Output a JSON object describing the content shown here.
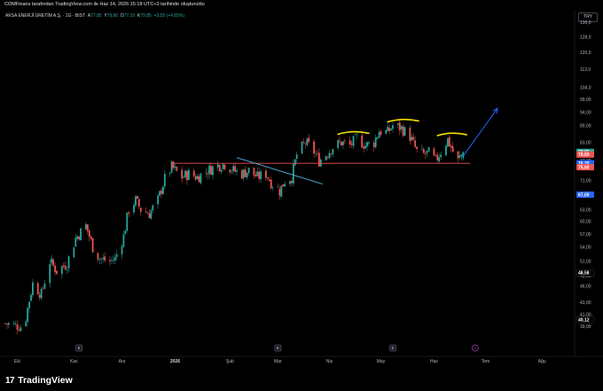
{
  "header": {
    "attribution": "COMFinans tarafından TradingView.com ile Haz 14, 2026 15:18 UTC+3 tarihinde oluşturuldu"
  },
  "legend": {
    "symbol": "AKSA ENERJİ ÜRETİM A.Ş. · 1G · BIST",
    "open_label": "A",
    "open": "77,85",
    "high_label": "Y",
    "high": "79,90",
    "low_label": "D",
    "low": "77,10",
    "close_label": "K",
    "close": "79,85",
    "change": "+3,55 (+4,65%)"
  },
  "currency_label": "TRY",
  "footer": {
    "brand": "TradingView",
    "logo": "17"
  },
  "colors": {
    "up": "#26a69a",
    "down": "#ef5350",
    "support": "#ef5350",
    "arrow": "#2962ff",
    "trend": "#4fb3e8",
    "arc": "#f7e000"
  },
  "chart_data": {
    "type": "candlestick",
    "y_scale": "log",
    "ylim": [
      35,
      136
    ],
    "xlim": [
      "2025-09-24",
      "2026-08-22"
    ],
    "y_ticks": [
      "136,0",
      "128,0",
      "120,0",
      "112,0",
      "104,0",
      "99,00",
      "94,00",
      "89,00",
      "83,00",
      "77,00",
      "71,00",
      "67,00",
      "63,00",
      "60,00",
      "57,00",
      "54,00",
      "51,00",
      "48,00",
      "46,00",
      "43,00",
      "41,00",
      "39,00"
    ],
    "y_tick_values": [
      136,
      128,
      120,
      112,
      104,
      99,
      94,
      89,
      83,
      77,
      71,
      67,
      63,
      60,
      57,
      54,
      51,
      48,
      46,
      43,
      41,
      39
    ],
    "x_ticks": [
      {
        "label": "Eki",
        "date": "2025-10-01",
        "bold": false
      },
      {
        "label": "Kas",
        "date": "2025-11-03",
        "bold": false
      },
      {
        "label": "Ara",
        "date": "2025-12-01",
        "bold": false
      },
      {
        "label": "2026",
        "date": "2026-01-01",
        "bold": true
      },
      {
        "label": "Şub",
        "date": "2026-02-02",
        "bold": false
      },
      {
        "label": "Mar",
        "date": "2026-03-02",
        "bold": false
      },
      {
        "label": "Nis",
        "date": "2026-04-01",
        "bold": false
      },
      {
        "label": "May",
        "date": "2026-05-01",
        "bold": false
      },
      {
        "label": "Haz",
        "date": "2026-06-01",
        "bold": false
      },
      {
        "label": "Tem",
        "date": "2026-07-01",
        "bold": false
      },
      {
        "label": "Ağu",
        "date": "2026-08-03",
        "bold": false
      }
    ],
    "price_badges": [
      {
        "label": "79,85",
        "value": 79.85,
        "color": "#26a69a"
      },
      {
        "label": "79,00",
        "value": 79.0,
        "color": "#ef5350"
      },
      {
        "label": "76,20",
        "value": 76.2,
        "color": "#2962ff"
      },
      {
        "label": "75,00",
        "value": 75.0,
        "color": "#ef5350"
      },
      {
        "label": "67,00",
        "value": 67.0,
        "color": "#2962ff"
      },
      {
        "label": "48,58",
        "value": 48.58,
        "color": "#000000"
      },
      {
        "label": "40,12",
        "value": 40.12,
        "color": "#000000"
      }
    ],
    "event_markers": [
      {
        "label": "E",
        "date": "2025-11-06"
      },
      {
        "label": "E",
        "date": "2026-03-02"
      },
      {
        "label": "E",
        "date": "2026-05-08"
      }
    ],
    "dividend_marker": {
      "label": "D",
      "date": "2026-06-25"
    },
    "support_level": {
      "value": 76.2,
      "from": "2025-12-30",
      "to": "2026-06-22"
    },
    "trendline": {
      "from": [
        "2026-02-06",
        78.0
      ],
      "to": [
        "2026-03-28",
        70.0
      ]
    },
    "arrow": {
      "from": [
        "2026-06-18",
        78.5
      ],
      "to": [
        "2026-07-08",
        95.5
      ]
    },
    "arcs": [
      {
        "from": "2026-04-06",
        "to": "2026-04-24",
        "y": 86.5
      },
      {
        "from": "2026-05-05",
        "to": "2026-05-23",
        "y": 91.0
      },
      {
        "from": "2026-06-03",
        "to": "2026-06-20",
        "y": 86.0
      }
    ],
    "anchors": [
      [
        "2025-09-24",
        39.5
      ],
      [
        "2025-10-03",
        39.0
      ],
      [
        "2025-10-06",
        40.5
      ],
      [
        "2025-10-10",
        46.5
      ],
      [
        "2025-10-15",
        44.5
      ],
      [
        "2025-10-20",
        51.0
      ],
      [
        "2025-10-24",
        49.0
      ],
      [
        "2025-10-30",
        50.5
      ],
      [
        "2025-11-04",
        56.0
      ],
      [
        "2025-11-10",
        59.0
      ],
      [
        "2025-11-14",
        54.0
      ],
      [
        "2025-11-18",
        51.5
      ],
      [
        "2025-11-24",
        51.0
      ],
      [
        "2025-11-27",
        51.5
      ],
      [
        "2025-12-02",
        56.5
      ],
      [
        "2025-12-05",
        63.0
      ],
      [
        "2025-12-09",
        65.5
      ],
      [
        "2025-12-12",
        63.0
      ],
      [
        "2025-12-17",
        62.0
      ],
      [
        "2025-12-22",
        65.5
      ],
      [
        "2025-12-26",
        71.5
      ],
      [
        "2025-12-30",
        75.0
      ],
      [
        "2026-01-05",
        72.0
      ],
      [
        "2026-01-09",
        73.0
      ],
      [
        "2026-01-14",
        72.0
      ],
      [
        "2026-01-20",
        74.0
      ],
      [
        "2026-01-26",
        75.5
      ],
      [
        "2026-01-30",
        76.0
      ],
      [
        "2026-02-04",
        74.0
      ],
      [
        "2026-02-09",
        73.0
      ],
      [
        "2026-02-13",
        74.0
      ],
      [
        "2026-02-18",
        72.0
      ],
      [
        "2026-02-23",
        73.0
      ],
      [
        "2026-02-26",
        70.5
      ],
      [
        "2026-03-03",
        68.0
      ],
      [
        "2026-03-06",
        71.0
      ],
      [
        "2026-03-10",
        72.0
      ],
      [
        "2026-03-13",
        79.0
      ],
      [
        "2026-03-18",
        83.0
      ],
      [
        "2026-03-23",
        80.0
      ],
      [
        "2026-03-26",
        77.0
      ],
      [
        "2026-03-31",
        79.5
      ],
      [
        "2026-04-03",
        81.5
      ],
      [
        "2026-04-08",
        83.0
      ],
      [
        "2026-04-13",
        82.0
      ],
      [
        "2026-04-17",
        84.5
      ],
      [
        "2026-04-22",
        82.0
      ],
      [
        "2026-04-27",
        83.0
      ],
      [
        "2026-04-30",
        87.0
      ],
      [
        "2026-05-05",
        86.5
      ],
      [
        "2026-05-08",
        89.0
      ],
      [
        "2026-05-13",
        88.0
      ],
      [
        "2026-05-18",
        85.0
      ],
      [
        "2026-05-22",
        80.0
      ],
      [
        "2026-05-26",
        79.0
      ],
      [
        "2026-05-29",
        79.5
      ],
      [
        "2026-06-02",
        77.0
      ],
      [
        "2026-06-05",
        80.0
      ],
      [
        "2026-06-09",
        84.0
      ],
      [
        "2026-06-12",
        80.0
      ],
      [
        "2026-06-15",
        77.0
      ],
      [
        "2026-06-18",
        79.85
      ]
    ]
  }
}
